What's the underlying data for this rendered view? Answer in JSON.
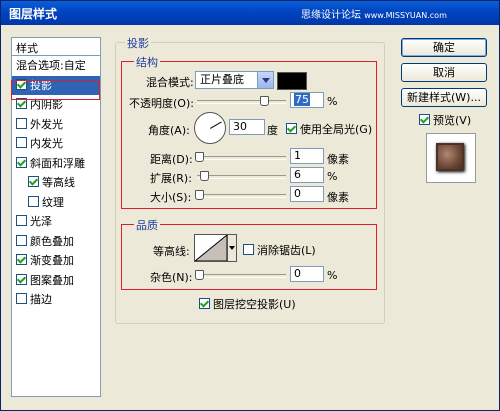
{
  "window": {
    "title": "图层样式"
  },
  "watermark": {
    "text": "思缘设计论坛",
    "site": "www.MISSYUAN.com"
  },
  "style_list": {
    "header": "样式",
    "items": [
      {
        "label": "混合选项:自定",
        "has_checkbox": false,
        "checked": false,
        "indent": false,
        "selected": false
      },
      {
        "label": "投影",
        "has_checkbox": true,
        "checked": true,
        "indent": false,
        "selected": true
      },
      {
        "label": "内阴影",
        "has_checkbox": true,
        "checked": true,
        "indent": false,
        "selected": false
      },
      {
        "label": "外发光",
        "has_checkbox": true,
        "checked": false,
        "indent": false,
        "selected": false
      },
      {
        "label": "内发光",
        "has_checkbox": true,
        "checked": false,
        "indent": false,
        "selected": false
      },
      {
        "label": "斜面和浮雕",
        "has_checkbox": true,
        "checked": true,
        "indent": false,
        "selected": false
      },
      {
        "label": "等高线",
        "has_checkbox": true,
        "checked": true,
        "indent": true,
        "selected": false
      },
      {
        "label": "纹理",
        "has_checkbox": true,
        "checked": false,
        "indent": true,
        "selected": false
      },
      {
        "label": "光泽",
        "has_checkbox": true,
        "checked": false,
        "indent": false,
        "selected": false
      },
      {
        "label": "颜色叠加",
        "has_checkbox": true,
        "checked": false,
        "indent": false,
        "selected": false
      },
      {
        "label": "渐变叠加",
        "has_checkbox": true,
        "checked": true,
        "indent": false,
        "selected": false
      },
      {
        "label": "图案叠加",
        "has_checkbox": true,
        "checked": true,
        "indent": false,
        "selected": false
      },
      {
        "label": "描边",
        "has_checkbox": true,
        "checked": false,
        "indent": false,
        "selected": false
      }
    ]
  },
  "panel": {
    "title": "投影",
    "structure": {
      "title": "结构",
      "blend_mode_label": "混合模式:",
      "blend_mode_value": "正片叠底",
      "blend_color": "#000000",
      "opacity_label": "不透明度(O):",
      "opacity_value": "75",
      "opacity_unit": "%",
      "opacity_fraction": 0.75,
      "angle_label": "角度(A):",
      "angle_value": "30",
      "angle_unit": "度",
      "global_light_label": "使用全局光(G)",
      "global_light_checked": true,
      "distance_label": "距离(D):",
      "distance_value": "1",
      "distance_unit": "像素",
      "spread_label": "扩展(R):",
      "spread_value": "6",
      "spread_unit": "%",
      "size_label": "大小(S):",
      "size_value": "0",
      "size_unit": "像素"
    },
    "quality": {
      "title": "品质",
      "contour_label": "等高线:",
      "anti_alias_label": "消除锯齿(L)",
      "anti_alias_checked": false,
      "noise_label": "杂色(N):",
      "noise_value": "0",
      "noise_unit": "%"
    },
    "knockout_label": "图层挖空投影(U)",
    "knockout_checked": true
  },
  "buttons": {
    "ok": "确定",
    "cancel": "取消",
    "new_style": "新建样式(W)...",
    "preview_label": "预览(V)",
    "preview_checked": true
  },
  "colors": {
    "accent": "#2f64b4",
    "highlight_box": "#d8202e",
    "group_title": "#1f3c9e"
  }
}
